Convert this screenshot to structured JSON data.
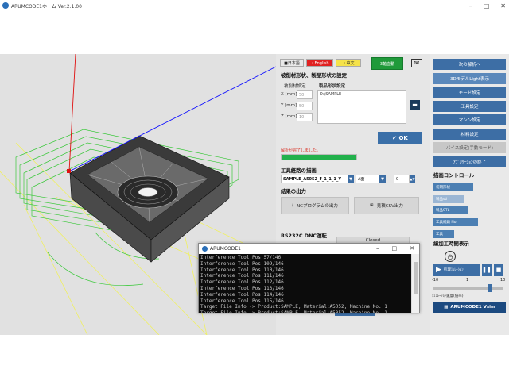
{
  "window": {
    "title": "ARUMCODE1ホーム Ver.2.1.00"
  },
  "lang": {
    "ja": "■日本語",
    "en": "・English",
    "zh": "・中文"
  },
  "buttons": {
    "mode3d": "3軸血動",
    "ok": "OK",
    "nc_output": "NCプログラムの出力",
    "csv_output": "見積CSV出力",
    "closed": "Closed"
  },
  "shape": {
    "section_title": "被削材形状、製品形状の設定",
    "work_label": "被削材設定",
    "product_label": "製品形状設定",
    "x_label": "X [mm]",
    "x_value": "50",
    "y_label": "Y [mm]",
    "y_value": "50",
    "z_label": "Z [mm]",
    "z_value": "10",
    "product_path": "D:\\SAMPLE"
  },
  "status": {
    "message": "解析が完了しました。",
    "progress": 1.0
  },
  "toolpath": {
    "section_title": "工具経路の描画",
    "file_select": "SAMPLE_A5052_F_1_1_1_Y",
    "face_select": "A面",
    "num_value": "0"
  },
  "output_title": "結果の出力",
  "dnc_title": "RS232C DNC運転",
  "right": {
    "next_analysis": "次の解析へ",
    "light_3d": "3DモデルLight表示",
    "mode_settings": "モード設定",
    "tool_settings": "工具設定",
    "machine_settings": "マシン設定",
    "material_settings": "材料設定",
    "vise_settings": "バイス設定(手動モード)",
    "app_exit": "ｱﾌﾟﾘｹｰｼｮﾝの終了",
    "draw_control": "描画コントロール",
    "workpiece": "初期形状",
    "product": "製品stl",
    "product_stl": "製品STL",
    "tool_path_no": "工具経路 No.",
    "tool": "工具",
    "total_time": "総加工時間表示",
    "sim_label": "処理ﾐｭﾚｰｼｮﾝ",
    "slider_min": "-10",
    "slider_mid": "1",
    "slider_max": "10",
    "slider_value": 0.82,
    "sim_speed": "ｼﾐｭﾚｰｼｮﾝ速度(倍率)",
    "vsim": "ARUMCODE1 Vsim"
  },
  "console": {
    "title": "ARUMCODE1",
    "lines": [
      "Interference Tool Pos 57/146",
      "Interference Tool Pos 109/146",
      "Interference Tool Pos 110/146",
      "Interference Tool Pos 111/146",
      "Interference Tool Pos 112/146",
      "Interference Tool Pos 113/146",
      "Interference Tool Pos 114/146",
      "Interference Tool Pos 115/146",
      "Target File Info -> Product:SAMPLE, Material:A5052, Machine No.:1",
      "Target File Info -> Product:SAMPLE, Material:A5052, Machine No.:1"
    ]
  },
  "colors": {
    "accent": "#3d6ea5",
    "progress": "#22b14c",
    "warn": "#d9362b",
    "mode_green": "#1f9a3a",
    "axis_x": "#1010ff",
    "axis_y": "#e01010",
    "toolpath": "#3cc83c",
    "guide": "#f0f060"
  }
}
